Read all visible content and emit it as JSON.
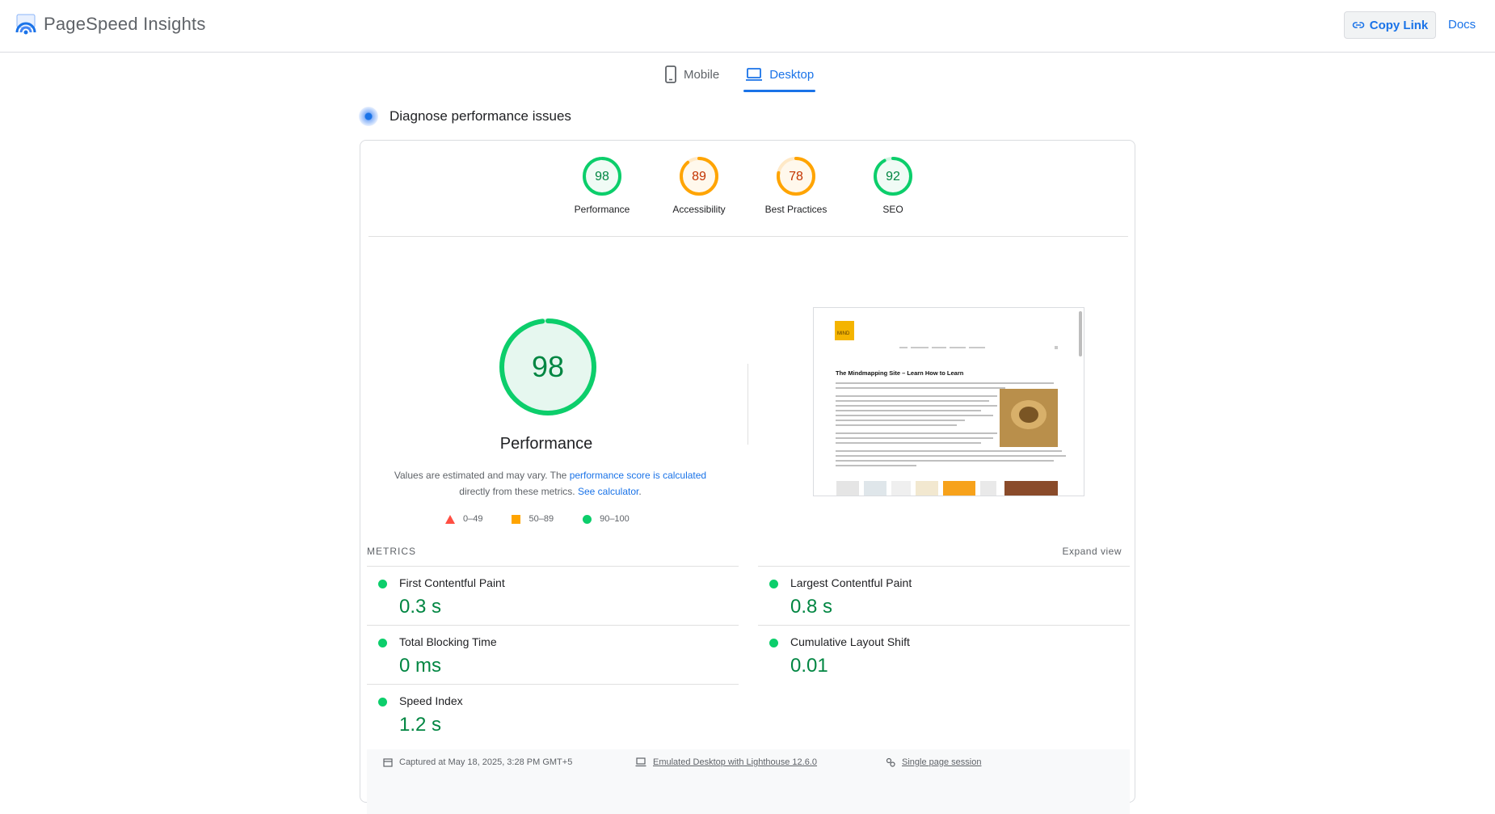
{
  "header": {
    "app_title": "PageSpeed Insights",
    "copy_link_label": "Copy Link",
    "docs_label": "Docs"
  },
  "tabs": [
    {
      "label": "Mobile",
      "active": false
    },
    {
      "label": "Desktop",
      "active": true
    }
  ],
  "diagnose": {
    "title": "Diagnose performance issues"
  },
  "scores": [
    {
      "label": "Performance",
      "value": "98",
      "status": "pass",
      "fraction": 0.98
    },
    {
      "label": "Accessibility",
      "value": "89",
      "status": "average",
      "fraction": 0.89
    },
    {
      "label": "Best Practices",
      "value": "78",
      "status": "average",
      "fraction": 0.78
    },
    {
      "label": "SEO",
      "value": "92",
      "status": "pass",
      "fraction": 0.92
    }
  ],
  "performance": {
    "score": "98",
    "fraction": 0.98,
    "title": "Performance",
    "desc_prefix": "Values are estimated and may vary. The",
    "desc_link1": "performance score is calculated",
    "desc_mid": "directly from these metrics.",
    "desc_link2": "See calculator",
    "desc_end": "."
  },
  "legend": {
    "fail": "0–49",
    "average": "50–89",
    "pass": "90–100"
  },
  "screenshot": {
    "site_title": "The Mindmapping Site – Learn How to Learn",
    "logo_text": "MIND"
  },
  "metrics": {
    "heading": "METRICS",
    "expand_label": "Expand view",
    "fcp": {
      "name": "First Contentful Paint",
      "value": "0.3 s"
    },
    "lcp": {
      "name": "Largest Contentful Paint",
      "value": "0.8 s"
    },
    "tbt": {
      "name": "Total Blocking Time",
      "value": "0 ms"
    },
    "cls": {
      "name": "Cumulative Layout Shift",
      "value": "0.01"
    },
    "si": {
      "name": "Speed Index",
      "value": "1.2 s"
    }
  },
  "info": {
    "captured": "Captured at May 18, 2025, 3:28 PM GMT+5",
    "emulated": "Emulated Desktop with Lighthouse 12.6.0",
    "session": "Single page session"
  },
  "colors": {
    "pass": "#0cce6b",
    "pass_text": "#018642",
    "average": "#ffa400",
    "average_text": "#c33300",
    "fail": "#ff4e42",
    "accent": "#1a73e8"
  }
}
